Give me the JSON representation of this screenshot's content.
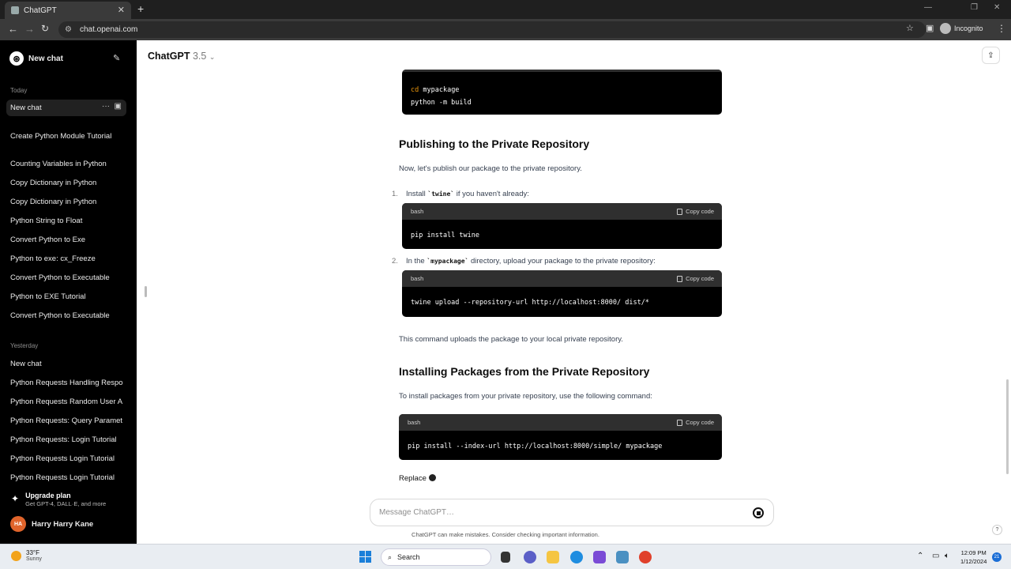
{
  "browser": {
    "tab_title": "ChatGPT",
    "url": "chat.openai.com",
    "incognito_label": "Incognito"
  },
  "sidebar": {
    "new_chat_label": "New chat",
    "today_label": "Today",
    "active_item": "New chat",
    "today_items": [
      "Create Python Module Tutorial",
      "Counting Variables in Python",
      "Copy Dictionary in Python",
      "Copy Dictionary in Python",
      "Python String to Float",
      "Convert Python to Exe",
      "Python to exe: cx_Freeze",
      "Convert Python to Executable",
      "Python to EXE Tutorial",
      "Convert Python to Executable"
    ],
    "yesterday_label": "Yesterday",
    "yesterday_items": [
      "New chat",
      "Python Requests Handling Respo",
      "Python Requests Random User A",
      "Python Requests: Query Paramet",
      "Python Requests: Login Tutorial",
      "Python Requests Login Tutorial",
      "Python Requests Login Tutorial"
    ],
    "upgrade_title": "Upgrade plan",
    "upgrade_sub": "Get GPT-4, DALL·E, and more",
    "user_initials": "HA",
    "user_name": "Harry Harry Kane"
  },
  "header": {
    "model_name": "ChatGPT",
    "model_version": "3.5"
  },
  "content": {
    "top_code_kw": "cd",
    "top_code_line1_rest": " mypackage",
    "top_code_line2": "python -m build",
    "h_publish": "Publishing to the Private Repository",
    "p_publish": "Now, let's publish our package to the private repository.",
    "step1_num": "1.",
    "step1_pre": "Install ",
    "step1_code": "`twine`",
    "step1_post": " if you haven't already:",
    "code1_lang": "bash",
    "code1_copy": "Copy code",
    "code1_body": "pip install twine",
    "step2_num": "2.",
    "step2_pre": "In the ",
    "step2_code": "`mypackage`",
    "step2_post": " directory, upload your package to the private repository:",
    "code2_lang": "bash",
    "code2_copy": "Copy code",
    "code2_body": "twine upload --repository-url http://localhost:8000/ dist/*",
    "p_uploads": "This command uploads the package to your local private repository.",
    "h_install": "Installing Packages from the Private Repository",
    "p_install": "To install packages from your private repository, use the following command:",
    "code3_lang": "bash",
    "code3_copy": "Copy code",
    "code3_body": "pip install --index-url http://localhost:8000/simple/ mypackage",
    "replace_text": "Replace"
  },
  "composer": {
    "placeholder": "Message ChatGPT…",
    "disclaimer": "ChatGPT can make mistakes. Consider checking important information."
  },
  "taskbar": {
    "temp": "33°F",
    "condition": "Sunny",
    "search_label": "Search",
    "time": "12:09 PM",
    "date": "1/12/2024",
    "notif_count": "21"
  }
}
